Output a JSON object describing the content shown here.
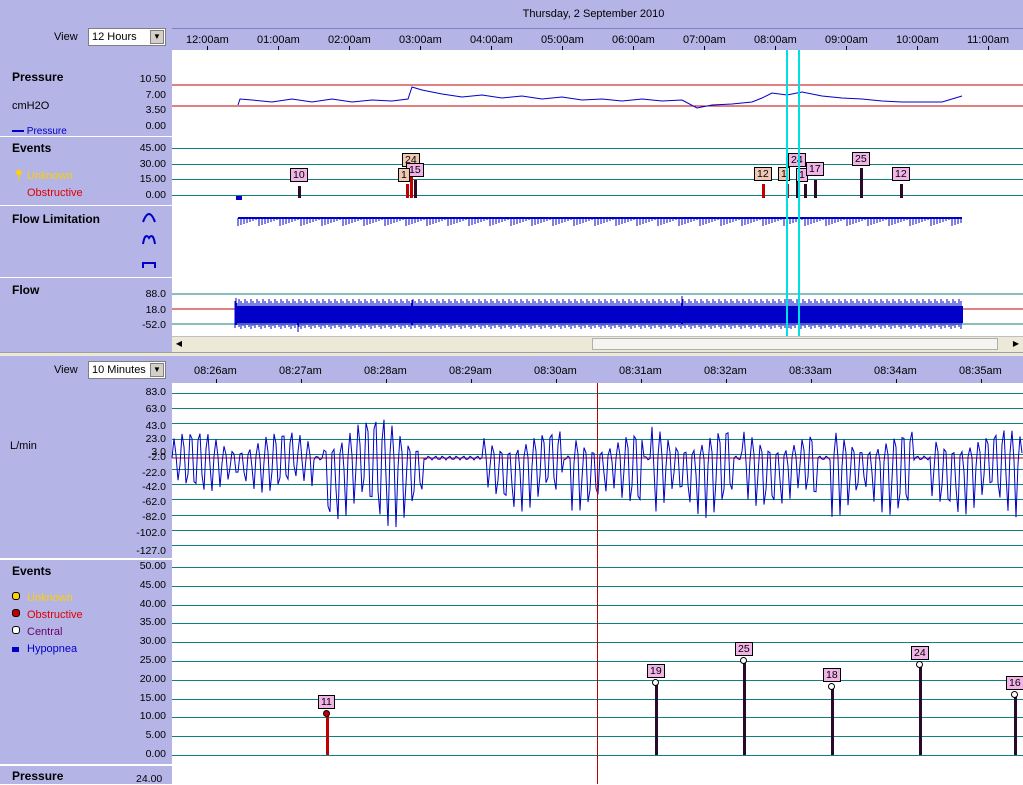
{
  "top": {
    "date": "Thursday, 2 September 2010",
    "view_label": "View",
    "view_value": "12 Hours",
    "hours": [
      "12:00am",
      "01:00am",
      "02:00am",
      "03:00am",
      "04:00am",
      "05:00am",
      "06:00am",
      "07:00am",
      "08:00am",
      "09:00am",
      "10:00am",
      "11:00am"
    ],
    "pressure": {
      "title": "Pressure",
      "unit": "cmH2O",
      "legend": "Pressure",
      "yticks": [
        "10.50",
        "7.00",
        "3.50",
        "0.00"
      ]
    },
    "events": {
      "title": "Events",
      "unknown": "Unknown",
      "obstructive": "Obstructive",
      "yticks": [
        "45.00",
        "30.00",
        "15.00",
        "0.00"
      ],
      "flags": [
        {
          "label": "10",
          "type": "central"
        },
        {
          "label": "24",
          "type": "obstructive"
        },
        {
          "label": "15",
          "type": "central"
        },
        {
          "label": "1",
          "type": "obstructive"
        },
        {
          "label": "12",
          "type": "obstructive"
        },
        {
          "label": "1",
          "type": "obstructive"
        },
        {
          "label": "24",
          "type": "central"
        },
        {
          "label": "1",
          "type": "central"
        },
        {
          "label": "17",
          "type": "central"
        },
        {
          "label": "25",
          "type": "central"
        },
        {
          "label": "12",
          "type": "central"
        }
      ]
    },
    "flow_limitation": {
      "title": "Flow Limitation"
    },
    "flow": {
      "title": "Flow",
      "yticks": [
        "88.0",
        "18.0",
        "-52.0"
      ]
    }
  },
  "bottom": {
    "view_label": "View",
    "view_value": "10 Minutes",
    "times": [
      "08:26am",
      "08:27am",
      "08:28am",
      "08:29am",
      "08:30am",
      "08:31am",
      "08:32am",
      "08:33am",
      "08:34am",
      "08:35am"
    ],
    "flow": {
      "unit": "L/min",
      "yticks": [
        "83.0",
        "63.0",
        "43.0",
        "23.0",
        "3.0",
        "-2.0",
        "-22.0",
        "-42.0",
        "-62.0",
        "-82.0",
        "-102.0",
        "-127.0"
      ]
    },
    "events": {
      "title": "Events",
      "unknown": "Unknown",
      "obstructive": "Obstructive",
      "central": "Central",
      "hypopnea": "Hypopnea",
      "yticks": [
        "50.00",
        "45.00",
        "40.00",
        "35.00",
        "30.00",
        "25.00",
        "20.00",
        "15.00",
        "10.00",
        "5.00",
        "0.00"
      ],
      "markers": [
        {
          "label": "11",
          "value": 11,
          "type": "obstructive"
        },
        {
          "label": "19",
          "value": 19,
          "type": "central"
        },
        {
          "label": "25",
          "value": 25,
          "type": "central"
        },
        {
          "label": "18",
          "value": 18,
          "type": "central"
        },
        {
          "label": "24",
          "value": 24,
          "type": "central"
        },
        {
          "label": "16",
          "value": 16,
          "type": "central"
        }
      ]
    },
    "pressure": {
      "title": "Pressure",
      "ytick": "24.00"
    }
  },
  "colors": {
    "panel": "#b4b4e6",
    "grid": "#0f7f7f",
    "signal": "#0000c8",
    "obstructive": "#c00000",
    "central": "#2a0a2a",
    "cursor": "#00e0e0"
  }
}
